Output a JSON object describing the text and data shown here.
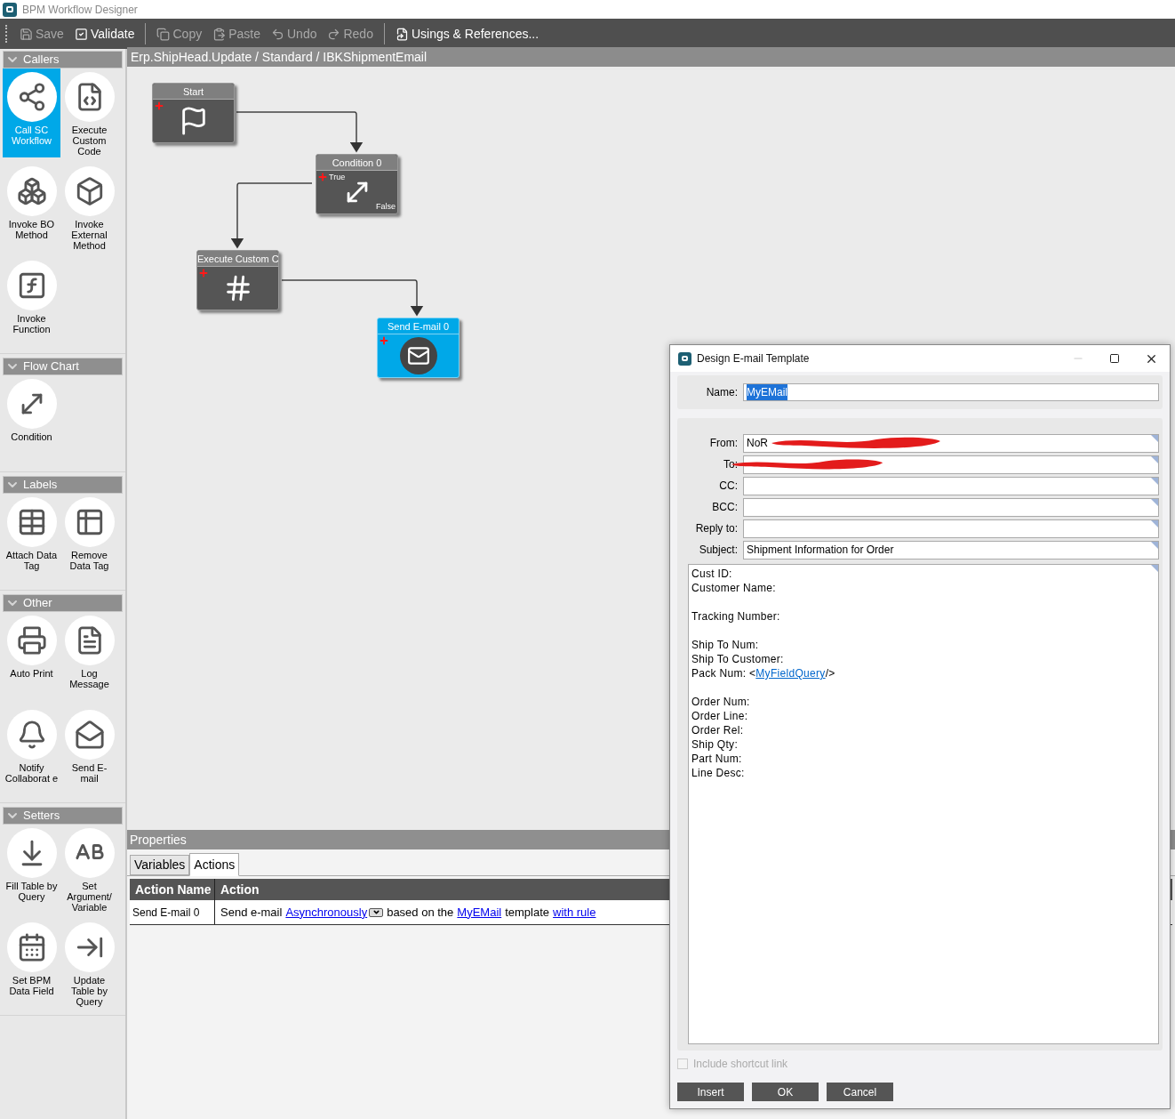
{
  "window": {
    "title": "BPM Workflow Designer"
  },
  "toolbar": [
    [
      {
        "label": "Save",
        "kind": "save",
        "disabled": true
      },
      {
        "label": "Validate",
        "kind": "validate",
        "disabled": false
      }
    ],
    [
      {
        "label": "Copy",
        "kind": "copy",
        "disabled": true
      },
      {
        "label": "Paste",
        "kind": "paste",
        "disabled": true
      },
      {
        "label": "Undo",
        "kind": "undo",
        "disabled": true
      },
      {
        "label": "Redo",
        "kind": "redo",
        "disabled": true
      }
    ],
    [
      {
        "label": "Usings & References...",
        "kind": "usings",
        "disabled": false
      }
    ]
  ],
  "breadcrumb": "Erp.ShipHead.Update / Standard / IBKShipmentEmail",
  "toolbox": [
    {
      "title": "Callers",
      "expanded": true,
      "items": [
        {
          "label": "Call SC Workflow",
          "kind": "workflow",
          "selected": true
        },
        {
          "label": "Execute Custom Code",
          "kind": "code",
          "selected": false
        },
        {
          "label": "Invoke BO Method",
          "kind": "bo",
          "selected": false
        },
        {
          "label": "Invoke External Method",
          "kind": "external",
          "selected": false
        },
        {
          "label": "Invoke Function",
          "kind": "function",
          "selected": false
        }
      ]
    },
    {
      "title": "Flow Chart",
      "expanded": true,
      "items": [
        {
          "label": "Condition",
          "kind": "condition",
          "selected": false
        }
      ]
    },
    {
      "title": "Labels",
      "expanded": true,
      "items": [
        {
          "label": "Attach Data Tag",
          "kind": "attach",
          "selected": false
        },
        {
          "label": "Remove Data Tag",
          "kind": "remove",
          "selected": false
        }
      ]
    },
    {
      "title": "Other",
      "expanded": true,
      "items": [
        {
          "label": "Auto Print",
          "kind": "print",
          "selected": false
        },
        {
          "label": "Log Message",
          "kind": "log",
          "selected": false
        },
        {
          "label": "Notify Collaborat e",
          "kind": "bell",
          "selected": false
        },
        {
          "label": "Send E- mail",
          "kind": "mail",
          "selected": false
        }
      ]
    },
    {
      "title": "Setters",
      "expanded": true,
      "items": [
        {
          "label": "Fill Table by Query",
          "kind": "fill",
          "selected": false
        },
        {
          "label": "Set Argument/ Variable",
          "kind": "abc",
          "selected": false
        },
        {
          "label": "Set BPM Data Field",
          "kind": "calendar",
          "selected": false
        },
        {
          "label": "Update Table by Query",
          "kind": "update",
          "selected": false
        }
      ]
    }
  ],
  "canvas": {
    "nodes": [
      {
        "title": "Start",
        "kind": "start",
        "selected": false
      },
      {
        "title": "Condition 0",
        "kind": "condition",
        "selected": false,
        "true_label": "True",
        "false_label": "False"
      },
      {
        "title": "Execute Custom C",
        "kind": "code",
        "selected": false
      },
      {
        "title": "Send E-mail 0",
        "kind": "mail",
        "selected": true
      }
    ]
  },
  "properties": {
    "title": "Properties",
    "tabs": [
      {
        "label": "Variables",
        "selected": false
      },
      {
        "label": "Actions",
        "selected": true
      }
    ],
    "columns": [
      "Action Name",
      "Action"
    ],
    "rows": [
      {
        "name": "Send E-mail 0",
        "action": [
          {
            "kind": "text",
            "text": "Send e-mail"
          },
          {
            "kind": "dropdown-link",
            "text": "Asynchronously"
          },
          {
            "kind": "text",
            "text": "based on the"
          },
          {
            "kind": "link",
            "text": "MyEMail"
          },
          {
            "kind": "text",
            "text": "template"
          },
          {
            "kind": "link",
            "text": "with rule"
          }
        ]
      }
    ]
  },
  "dialog": {
    "title": "Design E-mail Template",
    "name_label": "Name:",
    "name_value": "MyEMail",
    "fields": [
      {
        "label": "From:",
        "value": "NoR",
        "redacted": true
      },
      {
        "label": "To:",
        "redacted": true
      },
      {
        "label": "CC:",
        "redacted": false
      },
      {
        "label": "BCC:",
        "redacted": false
      },
      {
        "label": "Reply to:",
        "redacted": false
      },
      {
        "label": "Subject:",
        "value": "Shipment Information for Order",
        "redacted": false
      }
    ],
    "body": [
      [
        {
          "text": "Cust ID:"
        },
        {
          "text": "Customer Name:"
        }
      ],
      [
        {
          "text": "Tracking Number:"
        }
      ],
      [
        {
          "text": "Ship To Num:"
        },
        {
          "text": "Ship To Customer:"
        },
        {
          "text": "Pack Num: <",
          "link": "MyFieldQuery",
          "after": "/>"
        }
      ],
      [
        {
          "text": "Order Num:"
        },
        {
          "text": "Order Line:"
        },
        {
          "text": "Order Rel:"
        },
        {
          "text": "Ship Qty:"
        },
        {
          "text": "Part Num:"
        },
        {
          "text": "Line Desc:"
        }
      ]
    ],
    "include_shortcut_link": {
      "label": "Include shortcut link",
      "checked": false,
      "disabled": true
    },
    "buttons": [
      "Insert",
      "OK",
      "Cancel"
    ]
  }
}
